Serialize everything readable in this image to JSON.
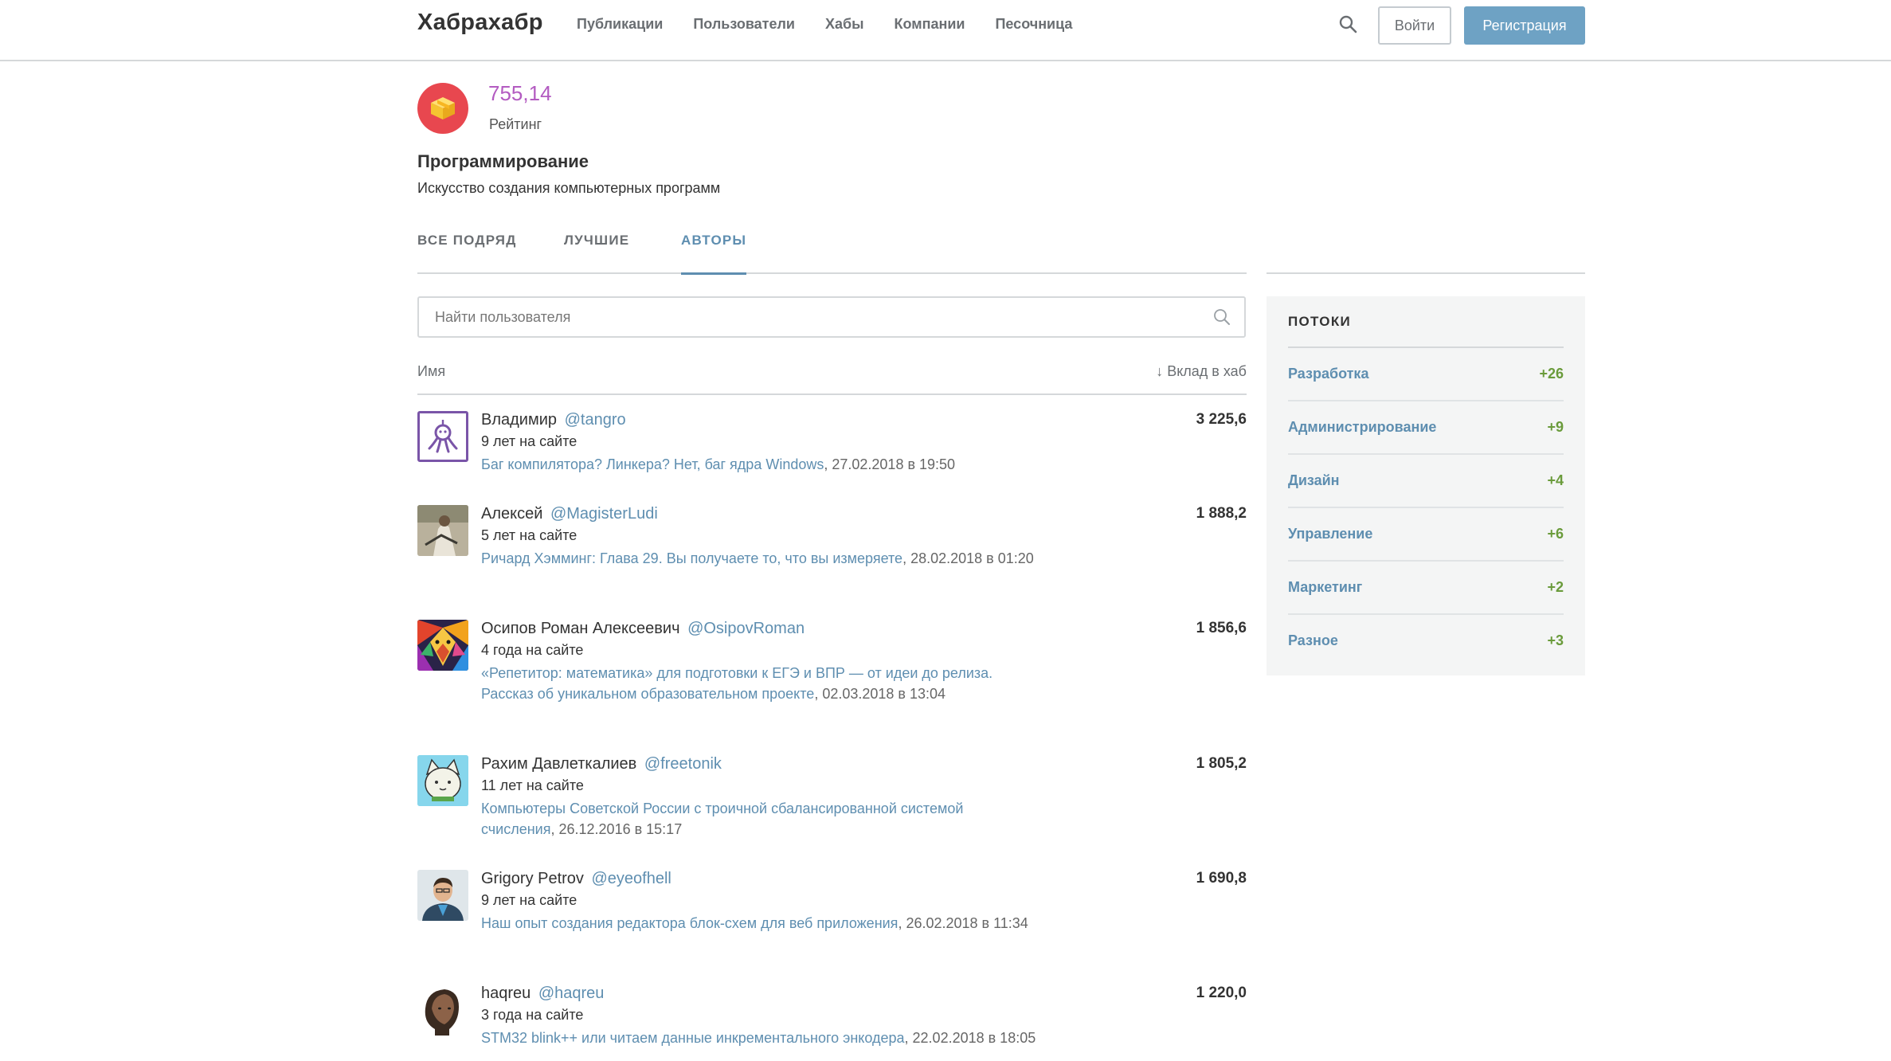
{
  "header": {
    "logo": "Хабрахабр",
    "nav": [
      "Публикации",
      "Пользователи",
      "Хабы",
      "Компании",
      "Песочница"
    ],
    "login": "Войти",
    "register": "Регистрация"
  },
  "hub": {
    "rating_value": "755,14",
    "rating_label": "Рейтинг",
    "title": "Программирование",
    "description": "Искусство создания компьютерных программ"
  },
  "tabs": [
    "ВСЕ ПОДРЯД",
    "ЛУЧШИЕ",
    "АВТОРЫ"
  ],
  "active_tab": "АВТОРЫ",
  "search": {
    "placeholder": "Найти пользователя"
  },
  "list_header": {
    "name": "Имя",
    "sort": "↓ Вклад в хаб"
  },
  "users": [
    {
      "name": "Владимир",
      "nick": "@tangro",
      "since": "9 лет на сайте",
      "post": "Баг компилятора? Линкера? Нет, баг ядра Windows",
      "date": ", 27.02.2018 в 19:50",
      "score": "3 225,6"
    },
    {
      "name": "Алексей",
      "nick": "@MagisterLudi",
      "since": "5 лет на сайте",
      "post": "Ричард Хэмминг: Глава 29. Вы получаете то, что вы измеряете",
      "date": ", 28.02.2018 в 01:20",
      "score": "1 888,2"
    },
    {
      "name": "Осипов Роман Алексеевич",
      "nick": "@OsipovRoman",
      "since": "4 года на сайте",
      "post": "«Репетитор: математика» для подготовки к ЕГЭ и ВПР — от идеи до релиза. Рассказ об уникальном образовательном проекте",
      "date": ", 02.03.2018 в 13:04",
      "score": "1 856,6"
    },
    {
      "name": "Рахим Давлеткалиев",
      "nick": "@freetonik",
      "since": "11 лет на сайте",
      "post": "Компьютеры Советской России с троичной сбалансированной системой счисления",
      "date": ", 26.12.2016 в 15:17",
      "score": "1 805,2"
    },
    {
      "name": "Grigory Petrov",
      "nick": "@eyeofhell",
      "since": "9 лет на сайте",
      "post": "Наш опыт создания редактора блок-схем для веб приложения",
      "date": ", 26.02.2018 в 11:34",
      "score": "1 690,8"
    },
    {
      "name": "haqreu",
      "nick": "@haqreu",
      "since": "3 года на сайте",
      "post": "STM32 blink++ или читаем данные инкрементального энкодера",
      "date": ", 22.02.2018 в 18:05",
      "score": "1 220,0"
    }
  ],
  "streams": {
    "title": "ПОТОКИ",
    "items": [
      {
        "name": "Разработка",
        "count": "+26"
      },
      {
        "name": "Администрирование",
        "count": "+9"
      },
      {
        "name": "Дизайн",
        "count": "+4"
      },
      {
        "name": "Управление",
        "count": "+6"
      },
      {
        "name": "Маркетинг",
        "count": "+2"
      },
      {
        "name": "Разное",
        "count": "+3"
      }
    ]
  },
  "colors": {
    "accent": "#5e8eb0",
    "register_button": "#6ea2c4",
    "rating": "#b35bc1",
    "hub_icon_bg": "#e8474f",
    "stream_count": "#6a9b3b"
  }
}
